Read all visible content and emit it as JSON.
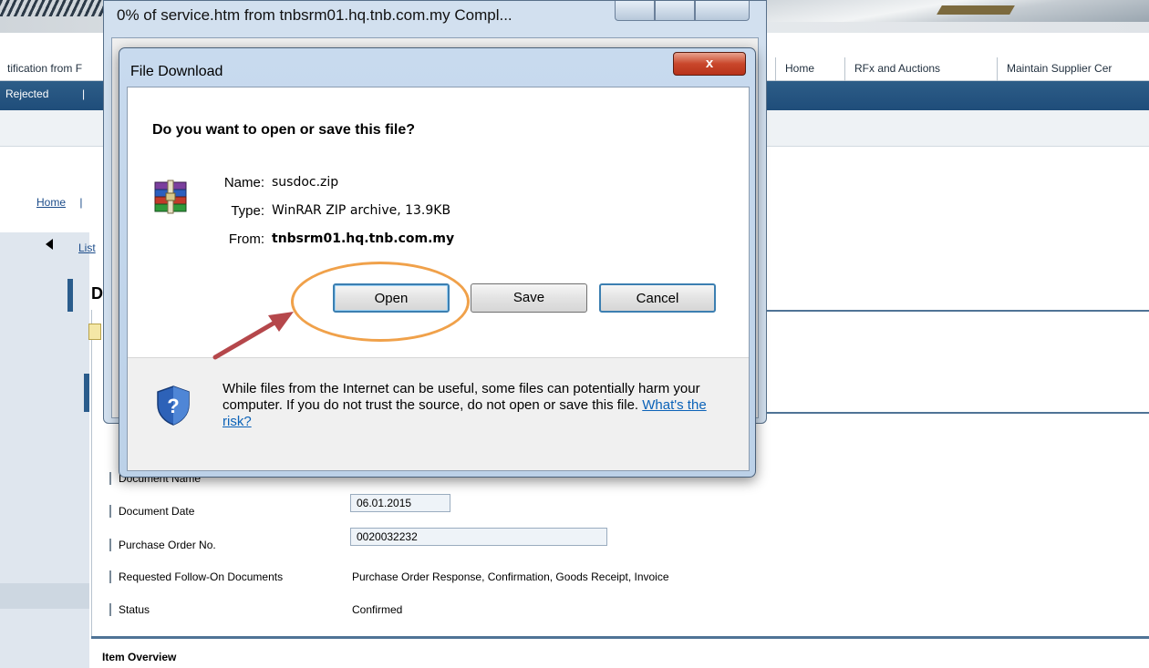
{
  "background_page": {
    "top_nav": {
      "items": [
        {
          "label": "tification from F"
        },
        {
          "label": "Home"
        },
        {
          "label": "RFx and Auctions"
        },
        {
          "label": "Maintain Supplier Cer"
        }
      ]
    },
    "blue_bar": {
      "label": "Rejected",
      "separator": "|"
    },
    "breadcrumb": {
      "home_label": "Home",
      "separator": "|"
    },
    "list_link": "List",
    "section_title": "D",
    "form": {
      "rows": [
        {
          "label": "Document Name",
          "value": ""
        },
        {
          "label": "Document Date",
          "value": "06.01.2015"
        },
        {
          "label": "Purchase Order No.",
          "value": "0020032232"
        },
        {
          "label": "Requested Follow-On Documents",
          "value": "Purchase Order Response, Confirmation, Goods Receipt, Invoice"
        },
        {
          "label": "Status",
          "value": "Confirmed"
        }
      ]
    },
    "item_overview_title": "Item Overview"
  },
  "progress_window": {
    "title": "0% of service.htm from tnbsrm01.hq.tnb.com.my Compl..."
  },
  "file_download_dialog": {
    "title": "File Download",
    "close_label": "x",
    "question": "Do you want to open or save this file?",
    "file": {
      "name_label": "Name:",
      "name": "susdoc.zip",
      "type_label": "Type:",
      "type": "WinRAR ZIP archive, 13.9KB",
      "from_label": "From:",
      "from": "tnbsrm01.hq.tnb.com.my",
      "icon": "winrar-archive-icon"
    },
    "buttons": {
      "open": "Open",
      "save": "Save",
      "cancel": "Cancel"
    },
    "warning": {
      "text": "While files from the Internet can be useful, some files can potentially harm your computer. If you do not trust the source, do not open or save this file.",
      "link": "What's the risk?",
      "icon": "shield-question-icon"
    }
  },
  "annotation": {
    "highlight_color": "#f0a14a",
    "arrow_color": "#b5474b"
  }
}
